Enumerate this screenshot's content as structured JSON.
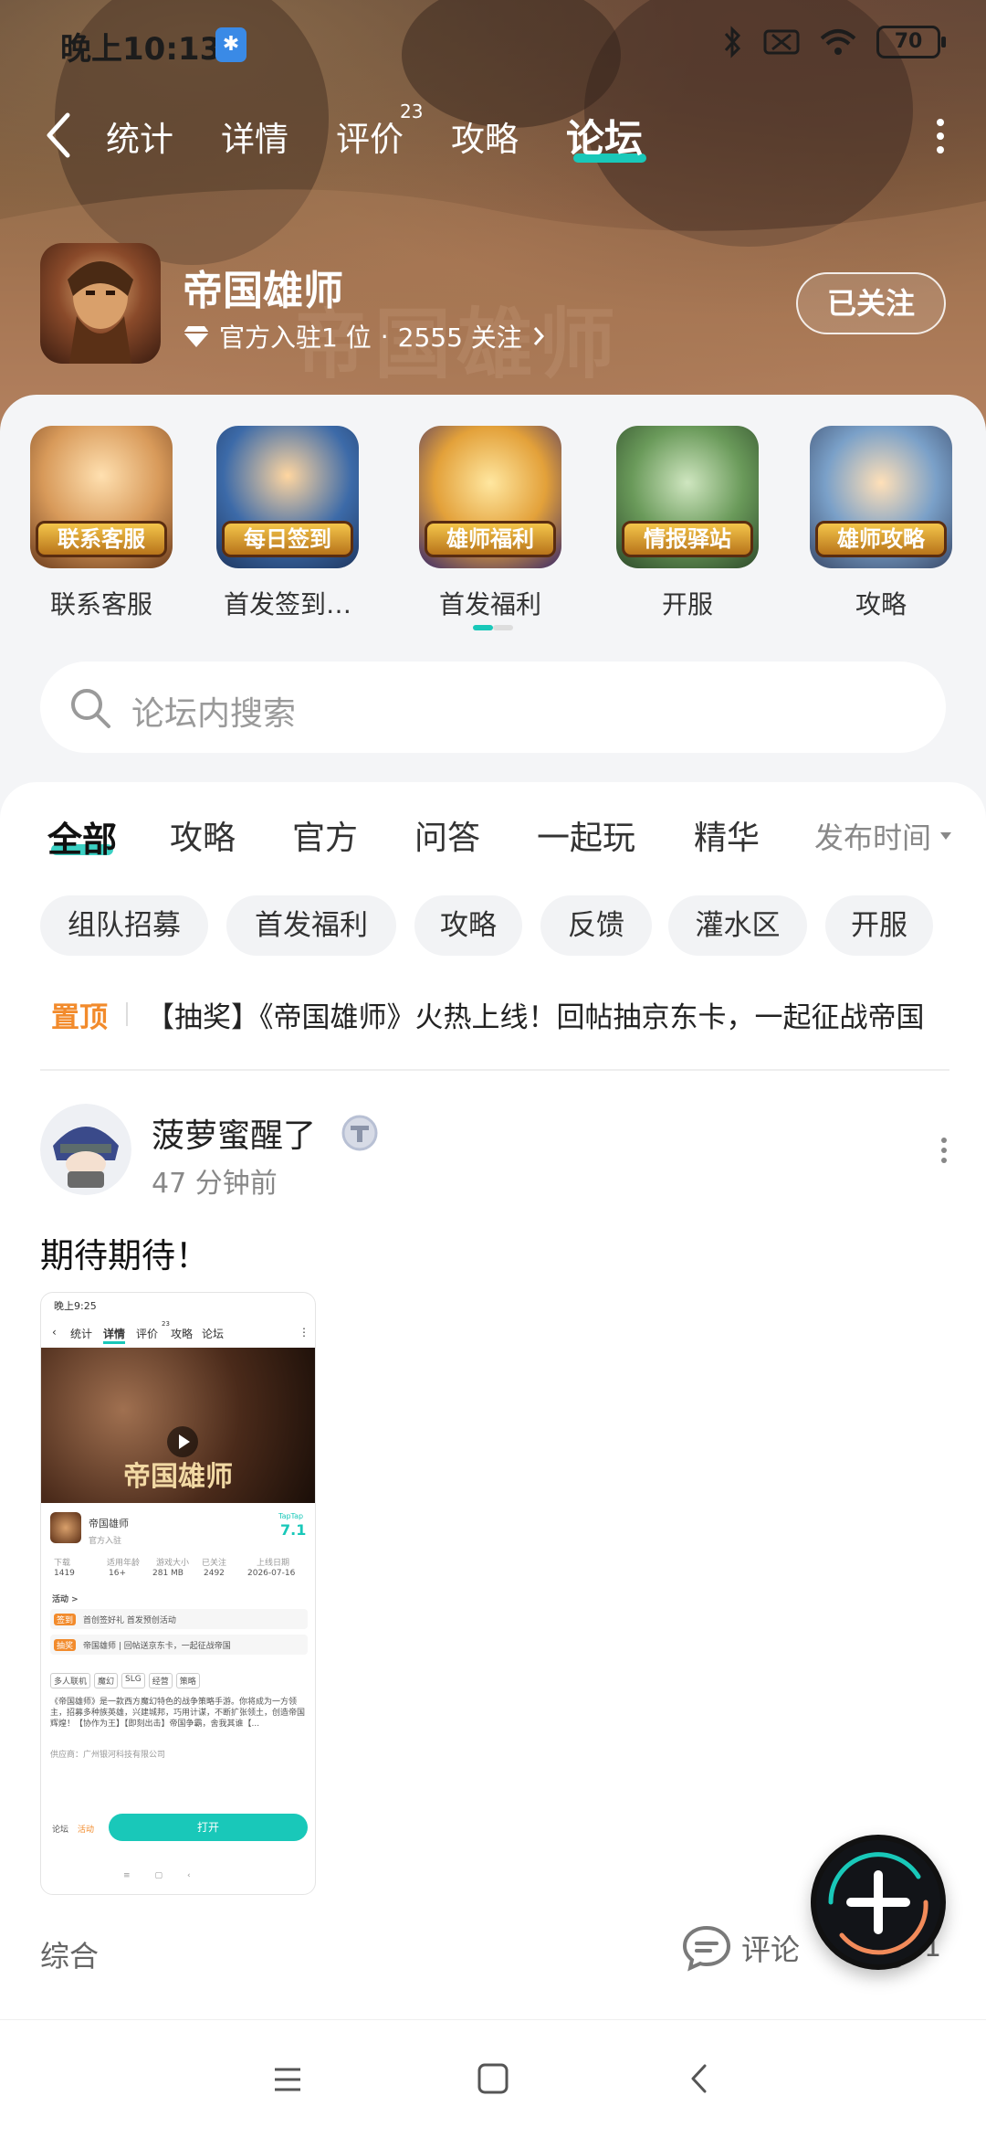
{
  "status_bar": {
    "time": "晚上10:13",
    "battery": "70"
  },
  "nav": {
    "tabs": [
      "统计",
      "详情",
      "评价",
      "攻略",
      "论坛"
    ],
    "active_tab": "论坛",
    "review_count": "23"
  },
  "game": {
    "name": "帝国雄师",
    "official": "官方入驻1 位",
    "separator": "·",
    "followers": "2555 关注",
    "follow_button": "已关注",
    "watermark": "帝国雄师"
  },
  "shortcuts": [
    {
      "banner": "联系客服",
      "label": "联系客服"
    },
    {
      "banner": "每日签到",
      "label": "首发签到…"
    },
    {
      "banner": "雄师福利",
      "label": "首发福利"
    },
    {
      "banner": "情报驿站",
      "label": "开服"
    },
    {
      "banner": "雄师攻略",
      "label": "攻略"
    }
  ],
  "search": {
    "placeholder": "论坛内搜索"
  },
  "filters": {
    "tabs": [
      "全部",
      "攻略",
      "官方",
      "问答",
      "一起玩",
      "精华"
    ],
    "active": "全部",
    "sort": "发布时间"
  },
  "chips": [
    "组队招募",
    "首发福利",
    "攻略",
    "反馈",
    "灌水区",
    "开服"
  ],
  "pinned": {
    "tag": "置顶",
    "text": "【抽奖】《帝国雄师》火热上线！回帖抽京东卡，一起征战帝国"
  },
  "post": {
    "author": "菠萝蜜醒了",
    "time": "47 分钟前",
    "text": "期待期待！",
    "category": "综合",
    "comment_label": "评论",
    "like_count": "1",
    "screenshot": {
      "time": "晚上9:25",
      "tabs": [
        "统计",
        "详情",
        "评价",
        "攻略",
        "论坛"
      ],
      "review_sup": "23",
      "video_title": "帝国雄师",
      "game_name": "帝国雄师",
      "official": "官方入驻",
      "rating_brand": "TapTap",
      "rating": "7.1",
      "stat_labels": [
        "下载",
        "适用年龄",
        "游戏大小",
        "已关注",
        "上线日期"
      ],
      "stat_values": [
        "1419",
        "16+",
        "281 MB",
        "2492",
        "2026-07-16"
      ],
      "events_title": "活动 >",
      "event1_tag": "签到",
      "event1": "首创签好礼 首发预创活动",
      "event2_tag": "抽奖",
      "event2": "帝国雄师 | 回帖送京东卡，一起征战帝国",
      "tags": [
        "多人联机",
        "魔幻",
        "SLG",
        "经营",
        "策略"
      ],
      "desc": "《帝国雄师》是一款西方魔幻特色的战争策略手游。你将成为一方领主，招募多种族英雄，兴建城邦，巧用计谋，不断扩张领土，创造帝国辉煌！【协作为王】【即刻出击】帝国争霸，舍我其谁【...",
      "dev": "供应商：广州银河科技有限公司",
      "open_label": "打开",
      "bottom_left": "论坛",
      "bottom_mid": "活动"
    }
  },
  "colors": {
    "accent": "#19c8b9",
    "pinned": "#f28b2c",
    "muted": "#888888"
  }
}
